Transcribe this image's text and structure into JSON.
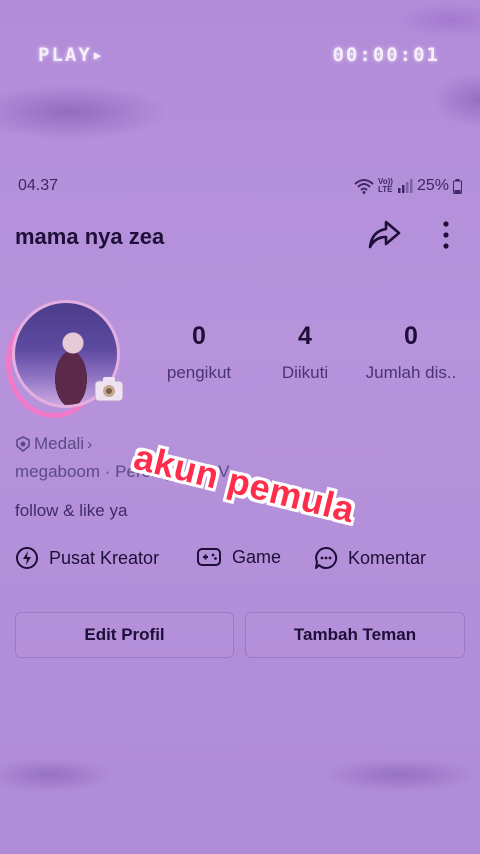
{
  "overlay": {
    "play_label": "PLAY▸",
    "timecode": "00:00:01"
  },
  "status_bar": {
    "time": "04.37",
    "network_label_top": "Vo))",
    "network_label_bottom": "LTE",
    "battery": "25%"
  },
  "profile": {
    "username": "mama nya zea",
    "stats": [
      {
        "value": "0",
        "label": "pengikut"
      },
      {
        "value": "4",
        "label": "Diikuti"
      },
      {
        "value": "0",
        "label": "Jumlah dis.."
      }
    ],
    "medal_label": "Medali",
    "info": "megaboom · Perempuan · V",
    "bio": "follow & like ya"
  },
  "actions": {
    "creator_center": "Pusat Kreator",
    "game": "Game",
    "comments": "Komentar"
  },
  "buttons": {
    "edit_profile": "Edit Profil",
    "add_friend": "Tambah Teman"
  },
  "sticker_text": "akun pemula"
}
